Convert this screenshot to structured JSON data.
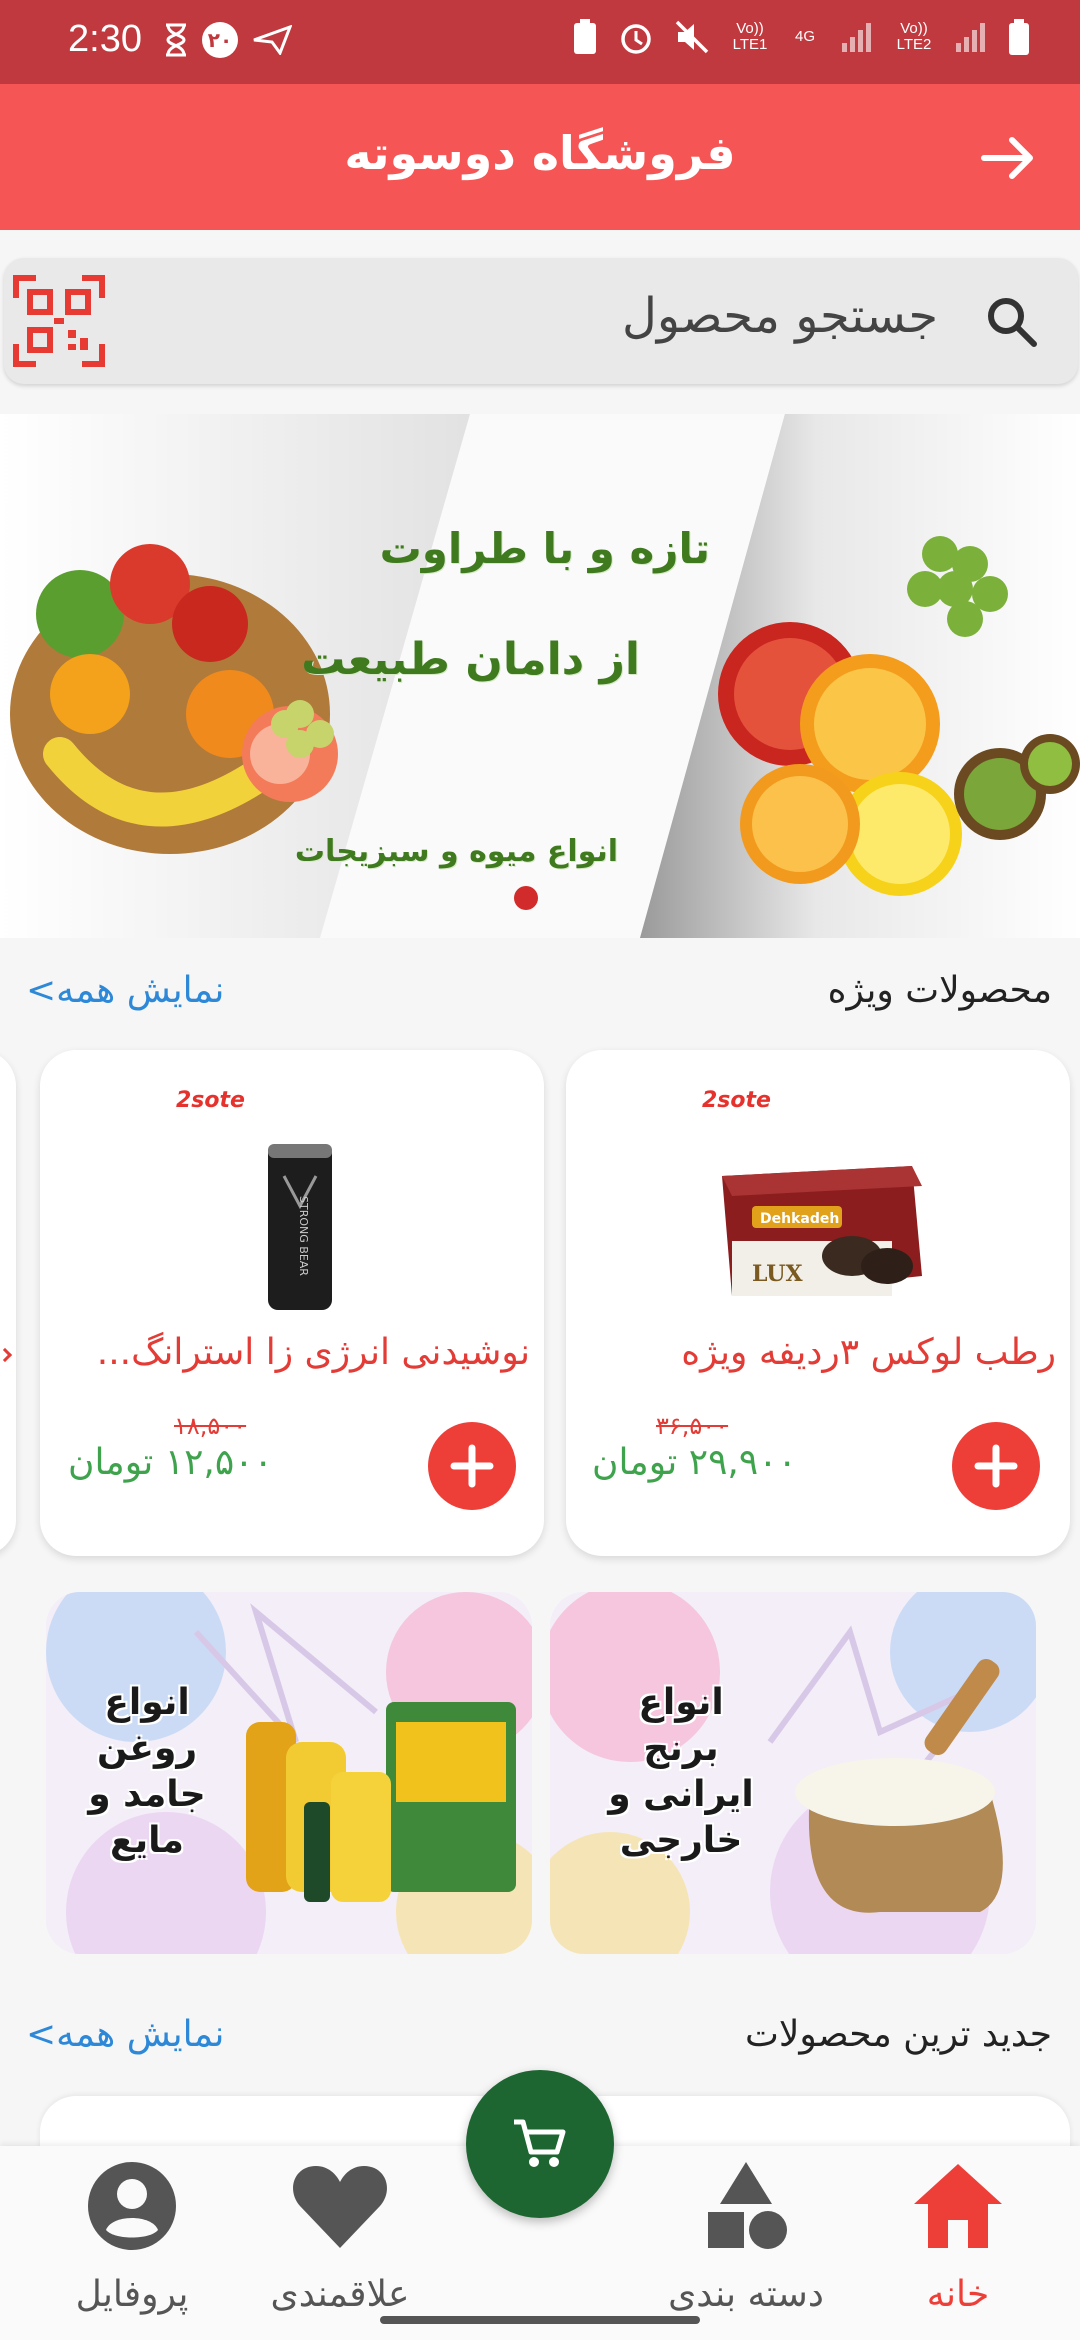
{
  "status_bar": {
    "time": "2:30",
    "notification_count": "۲۰",
    "network_1": "Vo)) LTE1",
    "network_2": "4G",
    "network_3": "Vo)) LTE2"
  },
  "header": {
    "title": "فروشگاه دوسوته"
  },
  "search": {
    "placeholder": "جستجو محصول"
  },
  "banner": {
    "line1": "تازه و با طراوت",
    "line2": "از دامان طبیعت",
    "line3": "انواع میوه و سبزیجات",
    "slide_indicator_count": 1
  },
  "special_products": {
    "title": "محصولات ویژه",
    "see_all": "نمایش همه>",
    "items": [
      {
        "brand_logo": "2sote",
        "name": "رطب لوکس  ۳ردیفه ویژه",
        "old_price": "۳۶,۵۰۰",
        "price": "۲۹,۹۰۰ تومان",
        "image_label": "Dehkadeh LUX"
      },
      {
        "brand_logo": "2sote",
        "name": "نوشیدنی انرژی زا استرانگ...",
        "old_price": "۱۸,۵۰۰",
        "price": "۱۲,۵۰۰ تومان",
        "image_label": "STRONG BEAR"
      }
    ]
  },
  "promos": [
    {
      "text": "انواع\nبرنج\nایرانی و خارجی"
    },
    {
      "text": "انواع\nروغن\nجامد و مایع"
    }
  ],
  "newest_products": {
    "title": "جدید ترین محصولات",
    "see_all": "نمایش همه>"
  },
  "bottom_nav": {
    "home": "خانه",
    "categories": "دسته بندی",
    "favorites": "علاقمندی",
    "profile": "پروفایل"
  },
  "colors": {
    "status_bar": "#c0393e",
    "header": "#f55555",
    "accent_red": "#ee3e38",
    "price_green": "#3fa34d",
    "link_blue": "#2e88d8",
    "cart_fab": "#1e6631"
  }
}
